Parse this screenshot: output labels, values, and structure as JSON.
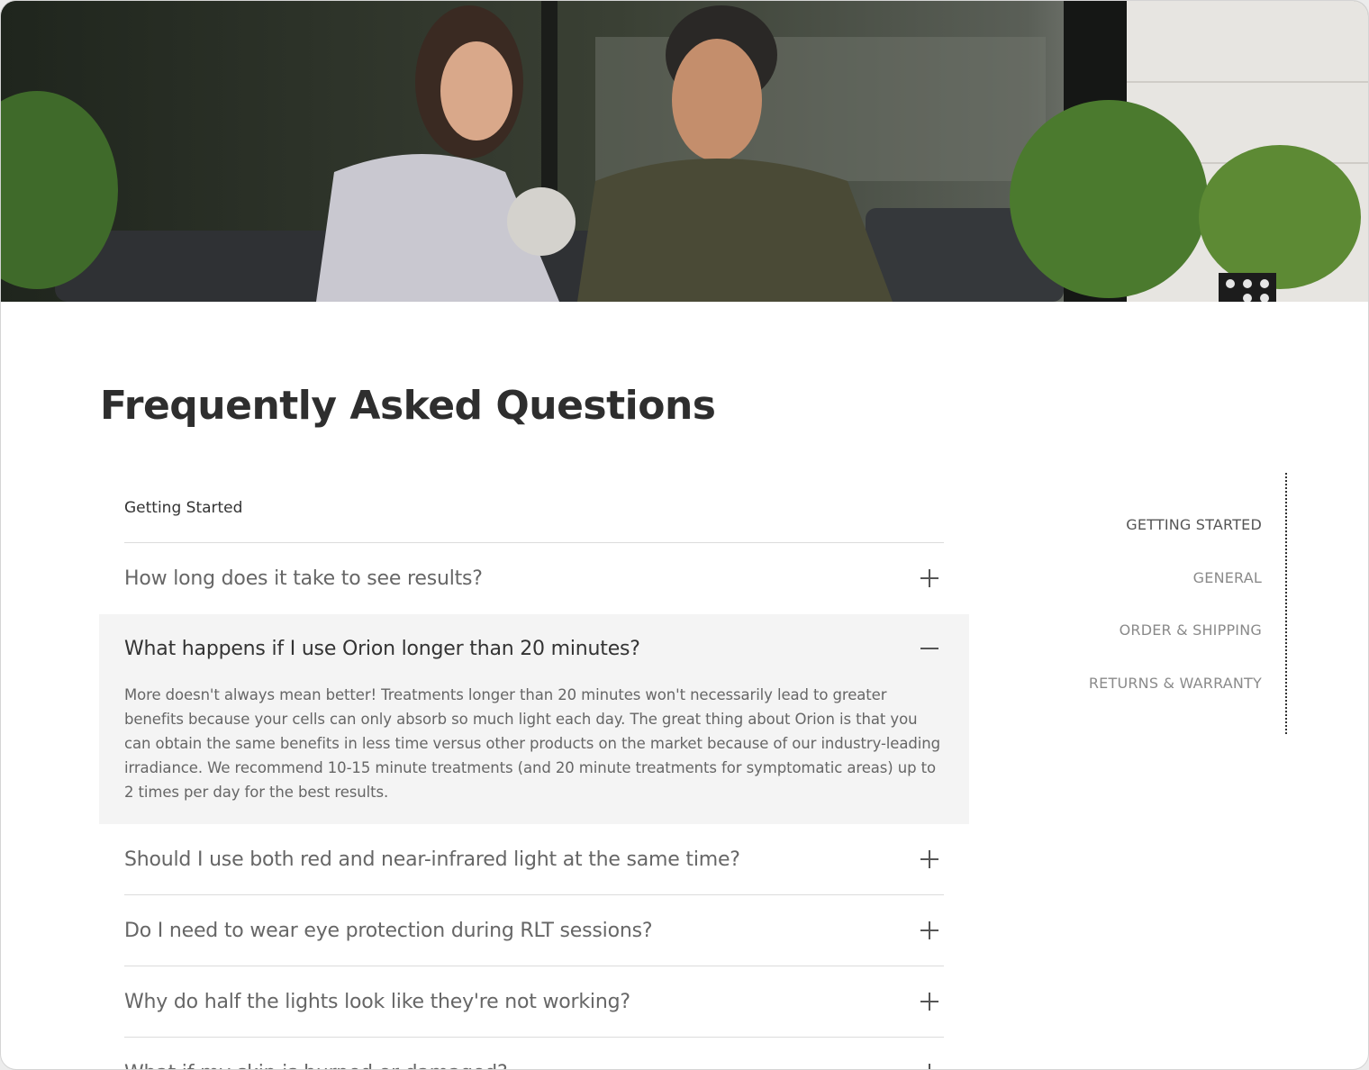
{
  "page": {
    "title": "Frequently Asked Questions"
  },
  "hero": {
    "image": "couple-sitting-on-porch-photo"
  },
  "section": {
    "label": "Getting Started"
  },
  "faq": [
    {
      "question": "How long does it take to see results?",
      "open": false
    },
    {
      "question": "What happens if I use Orion longer than 20 minutes?",
      "open": true,
      "answer": "More doesn't always mean better! Treatments longer than 20 minutes won't necessarily lead to greater benefits because your cells can only absorb so much light each day. The great thing about Orion is that you can obtain the same benefits in less time versus other products on the market because of our industry-leading irradiance. We recommend 10-15 minute treatments (and 20 minute treatments for symptomatic areas) up to 2 times per day for the best results."
    },
    {
      "question": "Should I use both red and near-infrared light at the same time?",
      "open": false
    },
    {
      "question": "Do I need to wear eye protection during RLT sessions?",
      "open": false
    },
    {
      "question": "Why do half the lights look like they're not working?",
      "open": false
    },
    {
      "question": "What if my skin is burned or damaged?",
      "open": false
    }
  ],
  "side_nav": [
    {
      "label": "GETTING STARTED",
      "active": true
    },
    {
      "label": "GENERAL",
      "active": false
    },
    {
      "label": "ORDER & SHIPPING",
      "active": false
    },
    {
      "label": "RETURNS & WARRANTY",
      "active": false
    }
  ],
  "icons": {
    "expand": "plus-icon",
    "collapse": "minus-icon"
  },
  "colors": {
    "title": "#2e2e2e",
    "open_bg": "#f4f4f4",
    "divider": "#dcdcdc",
    "nav": "#8a8a8a"
  }
}
